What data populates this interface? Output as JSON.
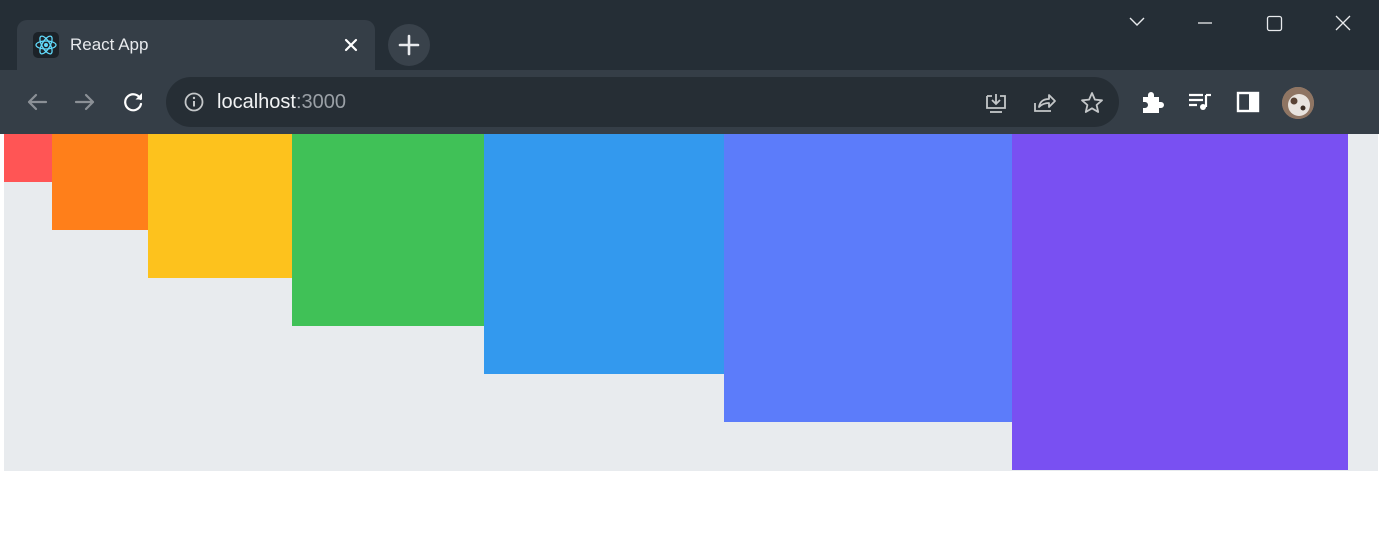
{
  "tab": {
    "title": "React App",
    "favicon": "react-icon"
  },
  "address_bar": {
    "host": "localhost",
    "port": ":3000"
  },
  "colors": {
    "frame": "#252e36",
    "toolbar": "#353e47",
    "omnibox": "#262e35",
    "page_background": "#e8ebee"
  },
  "boxes": [
    {
      "color": "#ff5555",
      "level": 1
    },
    {
      "color": "#ff7f1a",
      "level": 2
    },
    {
      "color": "#fdc21d",
      "level": 3
    },
    {
      "color": "#40c157",
      "level": 4
    },
    {
      "color": "#3399ee",
      "level": 5
    },
    {
      "color": "#5c7cfa",
      "level": 6
    },
    {
      "color": "#7950f2",
      "level": 7
    }
  ]
}
